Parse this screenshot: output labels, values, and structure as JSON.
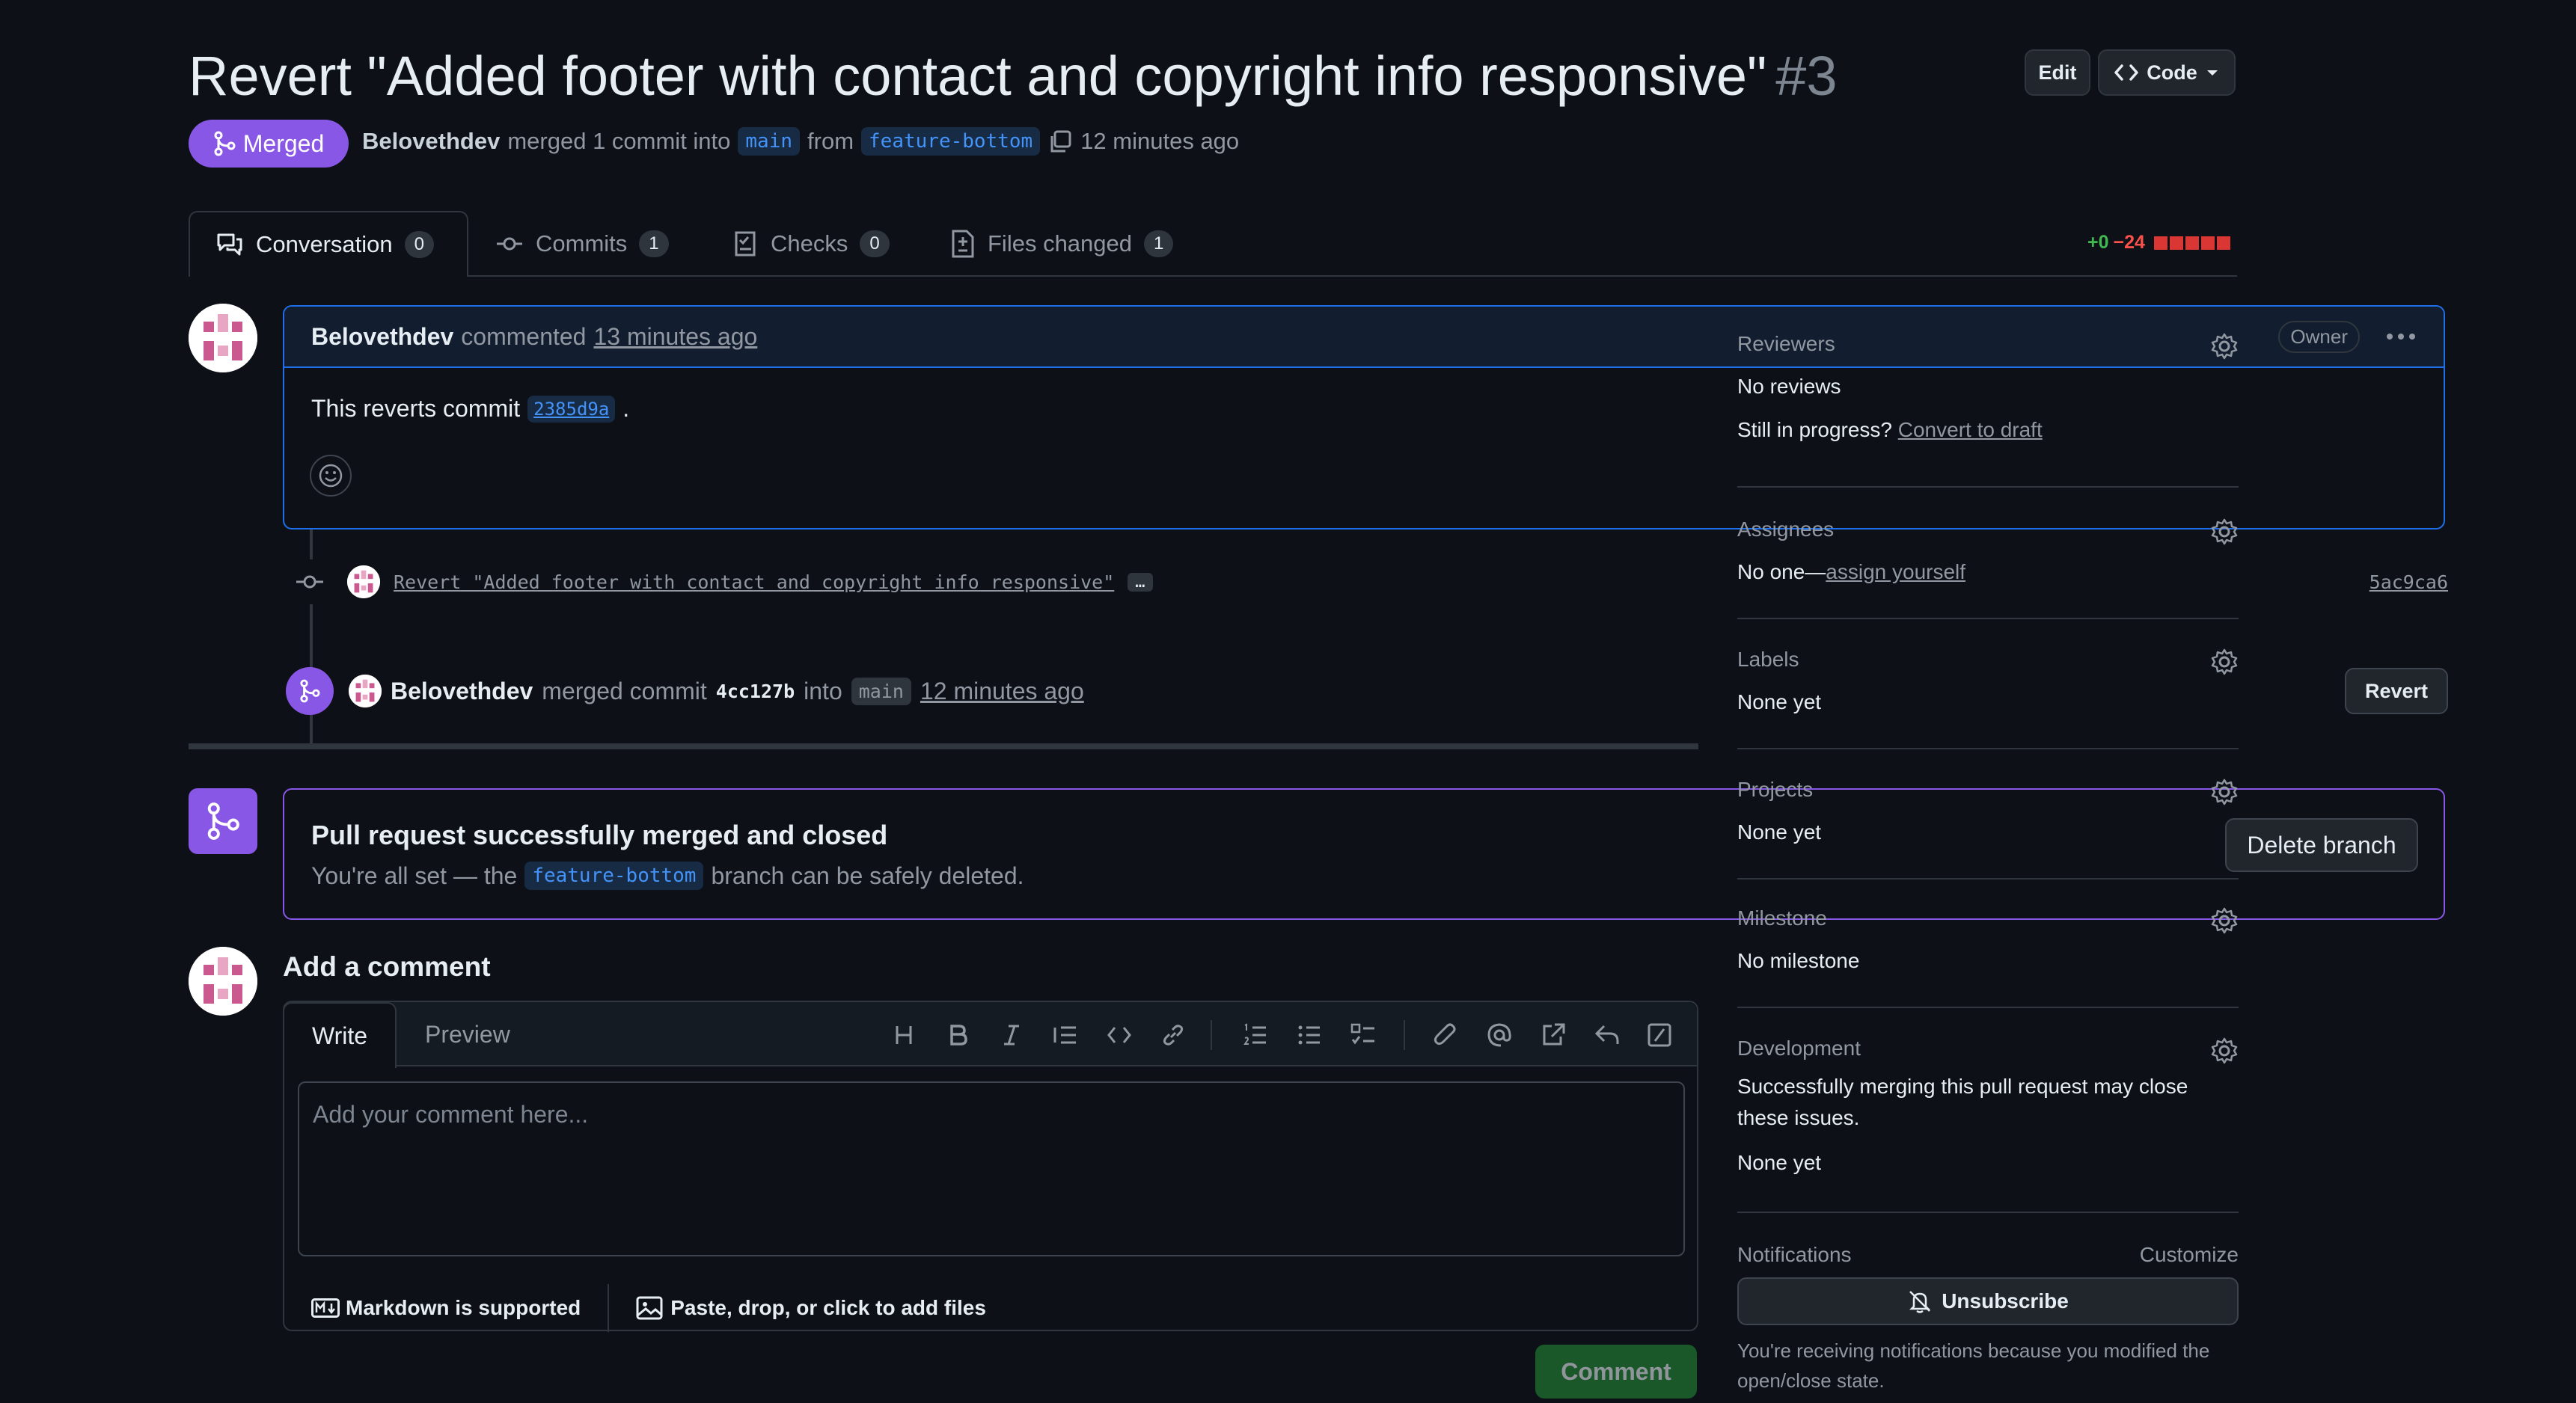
{
  "pr": {
    "title": "Revert \"Added footer with contact and copyright info responsive\"",
    "number": "#3",
    "edit_label": "Edit",
    "code_label": "Code",
    "state": "Merged",
    "author": "Belovethdev",
    "merge_text": "merged 1 commit into",
    "base_branch": "main",
    "from_text": "from",
    "head_branch": "feature-bottom",
    "time": "12 minutes ago"
  },
  "tabs": [
    {
      "label": "Conversation",
      "count": "0"
    },
    {
      "label": "Commits",
      "count": "1"
    },
    {
      "label": "Checks",
      "count": "0"
    },
    {
      "label": "Files changed",
      "count": "1"
    }
  ],
  "diffstat": {
    "added": "+0",
    "removed": "−24"
  },
  "comment": {
    "author": "Belovethdev",
    "action": "commented",
    "time": "13 minutes ago",
    "badge": "Owner",
    "body_prefix": "This reverts commit",
    "sha": "2385d9a",
    "body_suffix": "."
  },
  "commit": {
    "message": "Revert \"Added footer with contact and copyright info responsive\"",
    "ellipsis": "…",
    "sha": "5ac9ca6"
  },
  "merge_event": {
    "author": "Belovethdev",
    "text": "merged commit",
    "sha": "4cc127b",
    "into": "into",
    "branch": "main",
    "time": "12 minutes ago",
    "revert_label": "Revert"
  },
  "merged_box": {
    "title": "Pull request successfully merged and closed",
    "text_prefix": "You're all set — the",
    "branch": "feature-bottom",
    "text_suffix": "branch can be safely deleted.",
    "delete_label": "Delete branch"
  },
  "add_comment": {
    "heading": "Add a comment",
    "write_tab": "Write",
    "preview_tab": "Preview",
    "placeholder": "Add your comment here...",
    "markdown_note": "Markdown is supported",
    "files_note": "Paste, drop, or click to add files",
    "submit_label": "Comment"
  },
  "sidebar": {
    "reviewers": {
      "title": "Reviewers",
      "value": "No reviews",
      "draft_prefix": "Still in progress?",
      "draft_link": "Convert to draft"
    },
    "assignees": {
      "title": "Assignees",
      "prefix": "No one—",
      "link": "assign yourself"
    },
    "labels": {
      "title": "Labels",
      "value": "None yet"
    },
    "projects": {
      "title": "Projects",
      "value": "None yet"
    },
    "milestone": {
      "title": "Milestone",
      "value": "No milestone"
    },
    "development": {
      "title": "Development",
      "text": "Successfully merging this pull request may close these issues.",
      "value": "None yet"
    },
    "notifications": {
      "title": "Notifications",
      "customize": "Customize",
      "unsubscribe": "Unsubscribe",
      "reason": "You're receiving notifications because you modified the open/close state."
    }
  },
  "colors": {
    "accent": "#1f6feb",
    "merged": "#8957e5",
    "added": "#3fb950",
    "removed": "#f85149",
    "comment_btn": "#238636"
  }
}
